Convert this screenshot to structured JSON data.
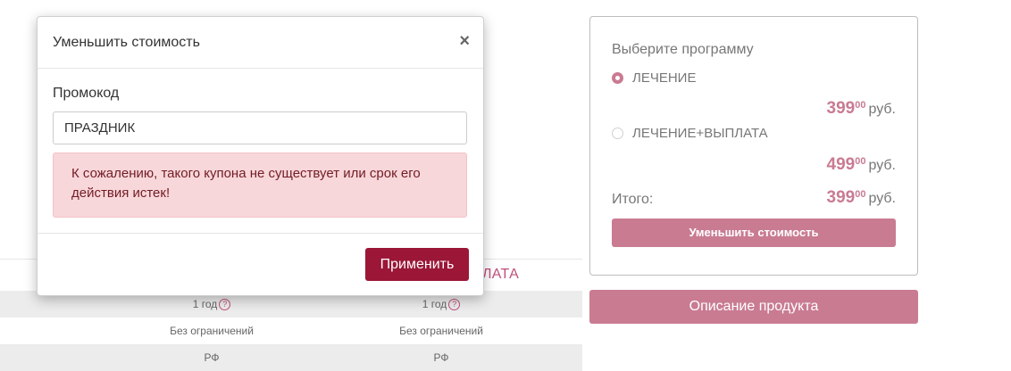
{
  "background_table": {
    "header_fragment": "ЛАТА",
    "rows": [
      {
        "col1": "1 год",
        "col2": "1 год",
        "help": "?"
      },
      {
        "col1": "Без ограничений",
        "col2": "Без ограничений"
      },
      {
        "col1": "РФ",
        "col2": "РФ"
      }
    ]
  },
  "program_card": {
    "title": "Выберите программу",
    "options": [
      {
        "label": "ЛЕЧЕНИЕ",
        "selected": true,
        "price_main": "399",
        "price_cents": "00",
        "currency": "руб."
      },
      {
        "label": "ЛЕЧЕНИЕ+ВЫПЛАТА",
        "selected": false,
        "price_main": "499",
        "price_cents": "00",
        "currency": "руб."
      }
    ],
    "total_label": "Итого:",
    "total_main": "399",
    "total_cents": "00",
    "total_currency": "руб.",
    "reduce_button": "Уменьшить стоимость"
  },
  "description_button": "Описание продукта",
  "modal": {
    "title": "Уменьшить стоимость",
    "close_symbol": "×",
    "field_label": "Промокод",
    "input_value": "ПРАЗДНИК",
    "alert_text": "К сожалению, такого купона не существует или срок его действия истек!",
    "apply_button": "Применить"
  },
  "colors": {
    "accent": "#c97b92",
    "apply_button": "#9b1637",
    "alert_background": "#f8d7da",
    "alert_text": "#721c24"
  }
}
